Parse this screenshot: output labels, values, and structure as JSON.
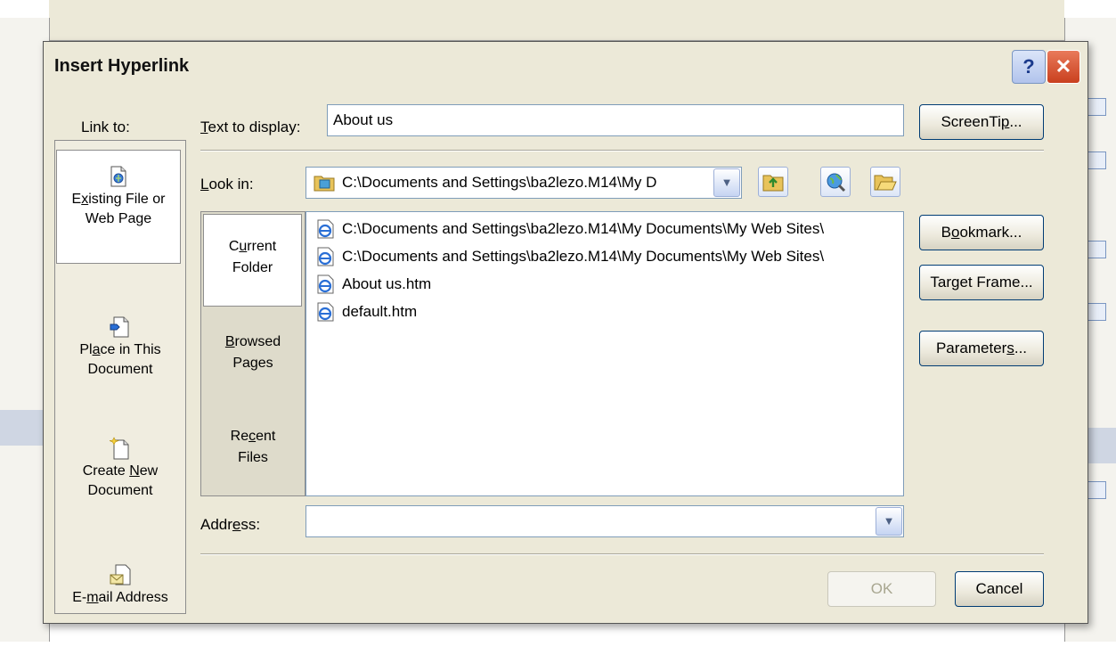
{
  "dialog": {
    "title": "Insert Hyperlink",
    "help_glyph": "?",
    "close_glyph": "✕"
  },
  "link_to": {
    "label": "Link to:",
    "items": [
      {
        "label_pre": "E",
        "label_u": "x",
        "label_post": "isting File or",
        "label2": "Web Page",
        "icon": "existing-file-icon"
      },
      {
        "label_pre": "Pl",
        "label_u": "a",
        "label_post": "ce in This",
        "label2": "Document",
        "icon": "place-in-document-icon"
      },
      {
        "label_pre": "Create ",
        "label_u": "N",
        "label_post": "ew",
        "label2": "Document",
        "icon": "new-document-icon"
      },
      {
        "label_pre": "E-",
        "label_u": "m",
        "label_post": "ail Address",
        "label2": "",
        "icon": "email-icon"
      }
    ]
  },
  "text_to_display": {
    "label_u": "T",
    "label_rest": "ext to display:",
    "value": "About us"
  },
  "look_in": {
    "label_u": "L",
    "label_rest": "ook in:",
    "value": "C:\\Documents and Settings\\ba2lezo.M14\\My D"
  },
  "tabs": [
    {
      "line1_pre": "C",
      "line1_u": "u",
      "line1_post": "rrent",
      "line2": "Folder"
    },
    {
      "line1_pre": "",
      "line1_u": "B",
      "line1_post": "rowsed",
      "line2": "Pages"
    },
    {
      "line1_pre": "Re",
      "line1_u": "c",
      "line1_post": "ent",
      "line2": "Files"
    }
  ],
  "files": [
    "C:\\Documents and Settings\\ba2lezo.M14\\My Documents\\My Web Sites\\",
    "C:\\Documents and Settings\\ba2lezo.M14\\My Documents\\My Web Sites\\",
    "About us.htm",
    "default.htm"
  ],
  "address": {
    "label_pre": "Addr",
    "label_u": "e",
    "label_post": "ss:",
    "value": ""
  },
  "buttons": {
    "screentip_pre": "ScreenTi",
    "screentip_u": "p",
    "screentip_post": "...",
    "bookmark_pre": "B",
    "bookmark_u": "o",
    "bookmark_post": "okmark...",
    "target_pre": "Tar",
    "target_u": "g",
    "target_post": "et Frame...",
    "params_pre": "Parameter",
    "params_u": "s",
    "params_post": "...",
    "ok": "OK",
    "cancel": "Cancel"
  },
  "colors": {
    "dialog_bg": "#ece9d8",
    "close_red": "#c9401e",
    "ie_blue": "#2a6fd6"
  }
}
